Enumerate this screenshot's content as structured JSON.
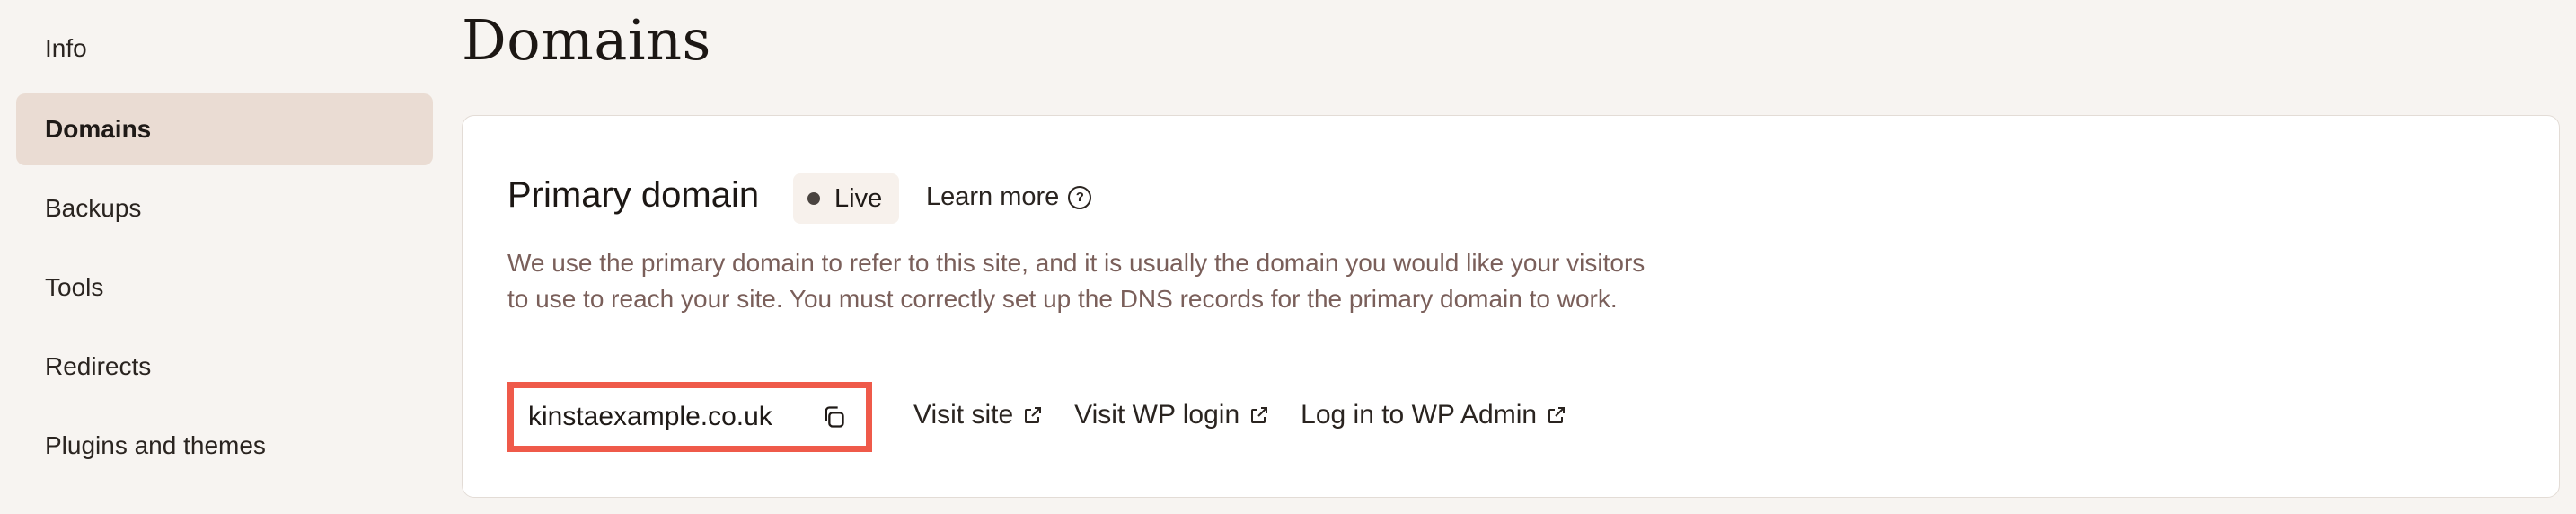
{
  "sidebar": {
    "items": [
      {
        "label": "Info",
        "active": false
      },
      {
        "label": "Domains",
        "active": true
      },
      {
        "label": "Backups",
        "active": false
      },
      {
        "label": "Tools",
        "active": false
      },
      {
        "label": "Redirects",
        "active": false
      },
      {
        "label": "Plugins and themes",
        "active": false
      }
    ]
  },
  "page": {
    "title": "Domains"
  },
  "primary_domain": {
    "title": "Primary domain",
    "status": "Live",
    "learn_more": "Learn more",
    "description": "We use the primary domain to refer to this site, and it is usually the domain you would like your visitors to use to reach your site. You must correctly set up the DNS records for the primary domain to work.",
    "domain": "kinstaexample.co.uk",
    "links": {
      "visit_site": "Visit site",
      "visit_wp_login": "Visit WP login",
      "wp_admin": "Log in to WP Admin"
    }
  },
  "colors": {
    "highlight_border": "#ef5a4a",
    "active_nav_bg": "#eadcd3",
    "description_text": "#7a5f5a"
  },
  "icons": {
    "help": "question-circle-icon",
    "copy": "copy-icon",
    "external": "external-link-icon",
    "status": "status-dot-icon"
  }
}
